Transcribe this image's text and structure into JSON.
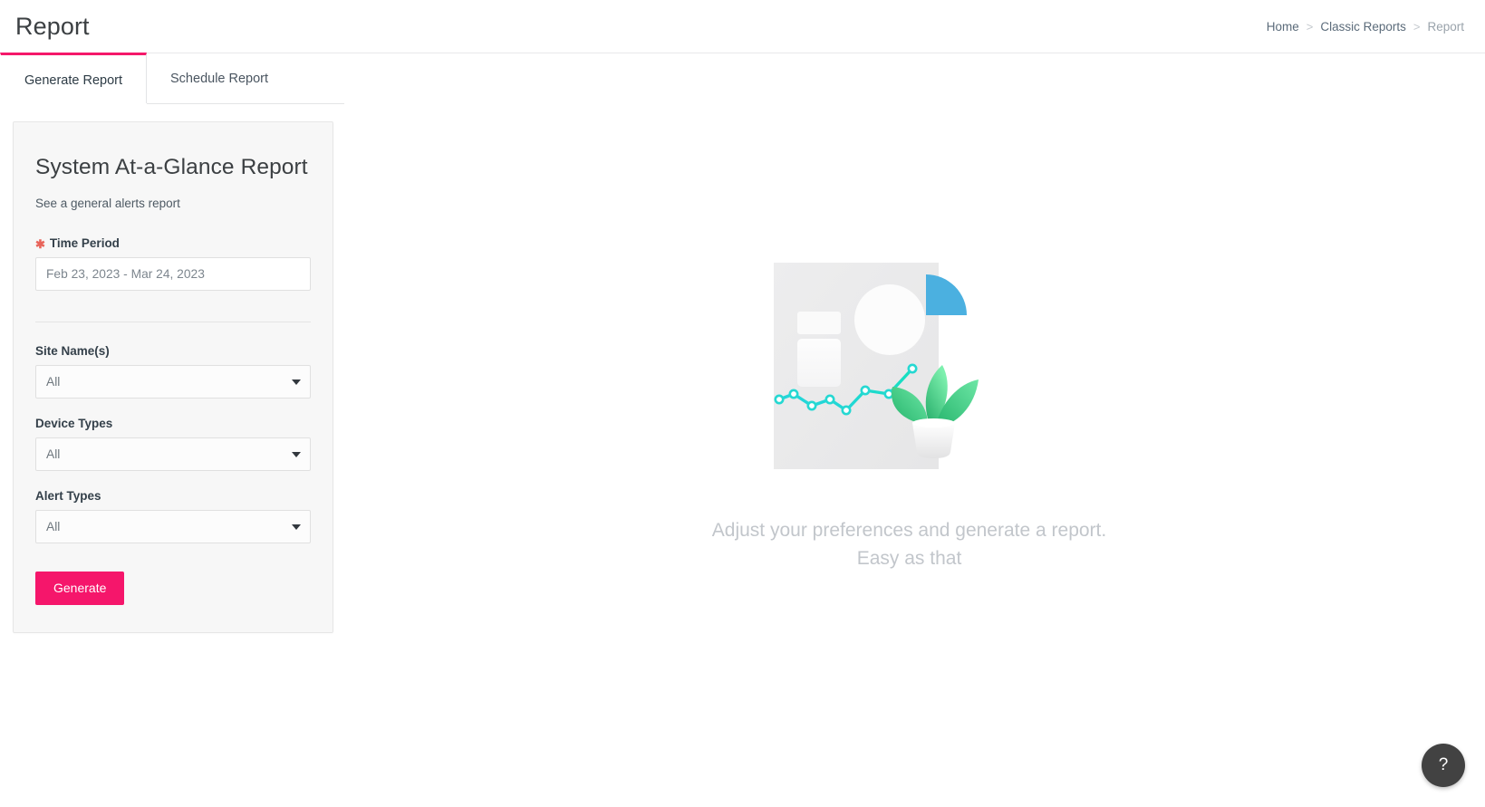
{
  "header": {
    "title": "Report",
    "breadcrumb": [
      {
        "label": "Home",
        "current": false
      },
      {
        "label": "Classic Reports",
        "current": false
      },
      {
        "label": "Report",
        "current": true
      }
    ],
    "separator": ">"
  },
  "tabs": [
    {
      "label": "Generate Report",
      "active": true
    },
    {
      "label": "Schedule Report",
      "active": false
    }
  ],
  "form": {
    "title": "System At-a-Glance Report",
    "subtitle": "See a general alerts report",
    "required_marker": "✱",
    "time_period": {
      "label": "Time Period",
      "value": "Feb 23, 2023 - Mar 24, 2023",
      "placeholder": "Feb 23, 2023 - Mar 24, 2023"
    },
    "site_names": {
      "label": "Site Name(s)",
      "value": "All"
    },
    "device_types": {
      "label": "Device Types",
      "value": "All"
    },
    "alert_types": {
      "label": "Alert Types",
      "value": "All"
    },
    "generate_label": "Generate"
  },
  "empty_state": {
    "line1": "Adjust your preferences and generate a report.",
    "line2": "Easy as that"
  },
  "help": {
    "label": "?"
  },
  "colors": {
    "accent_pink": "#f5166b",
    "panel_bg": "#f7f7f7",
    "illustration_blue": "#4bb0e0",
    "illustration_teal": "#22dcd0",
    "illustration_green": "#3ec98b",
    "empty_text": "#c2c6cb",
    "fab_bg": "#424242"
  }
}
